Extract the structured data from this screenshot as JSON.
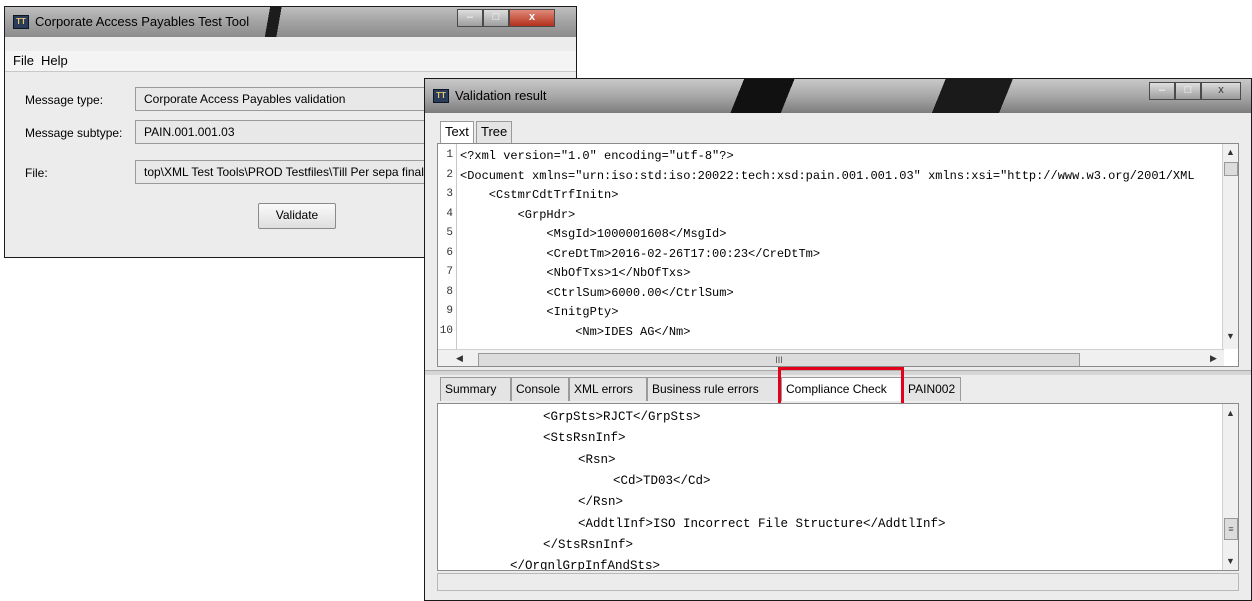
{
  "main_window": {
    "title": "Corporate Access Payables Test Tool",
    "menu": [
      "File",
      "Help"
    ],
    "fields": [
      {
        "label": "Message type:",
        "value": "Corporate Access Payables validation"
      },
      {
        "label": "Message subtype:",
        "value": "PAIN.001.001.03"
      },
      {
        "label": "File:",
        "value": "top\\XML Test Tools\\PROD Testfiles\\Till Per sepa final"
      }
    ],
    "validate_label": "Validate"
  },
  "result_window": {
    "title": "Validation result",
    "view_tabs": [
      "Text",
      "Tree"
    ],
    "scroll_marker": "III",
    "grip_marker": "≡",
    "code_lines": [
      {
        "n": "1",
        "text": "<?xml version=\"1.0\" encoding=\"utf-8\"?>"
      },
      {
        "n": "2",
        "text": "<Document xmlns=\"urn:iso:std:iso:20022:tech:xsd:pain.001.001.03\" xmlns:xsi=\"http://www.w3.org/2001/XML"
      },
      {
        "n": "3",
        "text": "    <CstmrCdtTrfInitn>"
      },
      {
        "n": "4",
        "text": "        <GrpHdr>"
      },
      {
        "n": "5",
        "text": "            <MsgId>1000001608</MsgId>"
      },
      {
        "n": "6",
        "text": "            <CreDtTm>2016-02-26T17:00:23</CreDtTm>"
      },
      {
        "n": "7",
        "text": "            <NbOfTxs>1</NbOfTxs>"
      },
      {
        "n": "8",
        "text": "            <CtrlSum>6000.00</CtrlSum>"
      },
      {
        "n": "9",
        "text": "            <InitgPty>"
      },
      {
        "n": "10",
        "text": "                <Nm>IDES AG</Nm>"
      }
    ],
    "result_tabs": [
      "Summary",
      "Console",
      "XML errors",
      "Business rule errors",
      "Compliance Check",
      "PAIN002"
    ],
    "selected_tab": "Compliance Check",
    "result_lines": [
      "<GrpSts>RJCT</GrpSts>",
      "<StsRsnInf>",
      "<Rsn>",
      "<Cd>TD03</Cd>",
      "</Rsn>",
      "<AddtlInf>ISO Incorrect File Structure</AddtlInf>",
      "</StsRsnInf>",
      "</OrgnlGrpInfAndSts>"
    ]
  },
  "highlight_color": "#e3001b"
}
